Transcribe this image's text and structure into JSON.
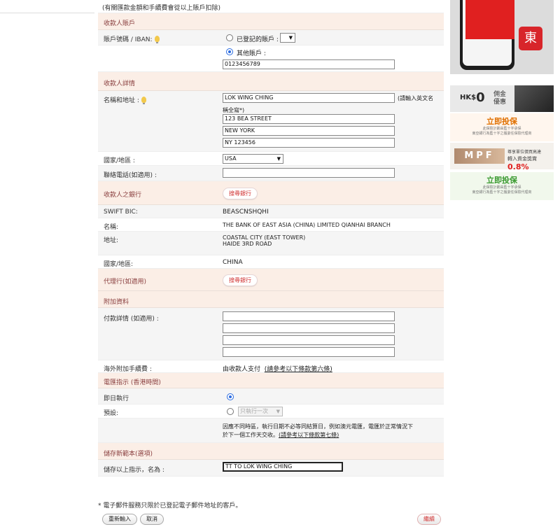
{
  "note_top": "(有關匯款金額和手續費會從以上賬戶扣除)",
  "payee_account": {
    "heading": "收款人賬戶",
    "account_label": "賬戶號碼 / IBAN:",
    "registered_label": "已登記的賬戶 :",
    "other_label": "其他賬戶 :",
    "account_value": "0123456789"
  },
  "payee_details": {
    "heading": "收款人詳情",
    "name_label": "名稱和地址 :",
    "name_value": "LOK WING CHING",
    "name_hint": "(請輸入英文名",
    "name_hint2": "稱全寫*)",
    "address1": "123 BEA STREET",
    "address2": "NEW YORK",
    "address3": "NY 123456",
    "country_label": "國家/地區 :",
    "country_value": "USA",
    "phone_label": "聯絡電話(如適用) :",
    "phone_value": ""
  },
  "payee_bank": {
    "heading": "收款人之銀行",
    "search_label": "搜尋銀行",
    "swift_label": "SWIFT BIC:",
    "swift_value": "BEASCNSHQHI",
    "bank_name_label": "名稱:",
    "bank_name_value": "THE BANK OF EAST ASIA (CHINA) LIMITED QIANHAI BRANCH",
    "address_label": "地址:",
    "address_line1": "COASTAL CITY (EAST TOWER)",
    "address_line2": "HAIDE 3RD ROAD",
    "country_label": "國家/地區:",
    "country_value": "CHINA"
  },
  "agent_bank": {
    "heading": "代理行(如適用)",
    "search_label": "搜尋銀行"
  },
  "additional": {
    "heading": "附加資料",
    "payment_details_label": "付款詳情 (如適用) :",
    "overseas_fee_label": "海外附加手續費 :",
    "overseas_fee_value": "由收款人支付",
    "overseas_fee_link": "(請參考以下條款第六條)"
  },
  "instruction": {
    "heading": "電匯指示 (香港時間)",
    "immediate_label": "即日執行",
    "schedule_label": "預設:",
    "schedule_select": "只執行一次",
    "notice_line1": "因應不同時區，執行日期不必等同結算日，例如澳元電匯，電匯於正常情況下",
    "notice_line2": "於下一個工作天交收。",
    "notice_link": "(請參考以下條款第七條)"
  },
  "template": {
    "heading": "儲存新範本(選項)",
    "save_label": "儲存以上指示，名為 :",
    "save_value": "TT TO LOK WING CHING"
  },
  "footnote": "* 電子郵件服務只限於已登記電子郵件地址的客戶。",
  "buttons": {
    "reset": "重新輸入",
    "cancel": "取消",
    "continue": "繼續"
  },
  "ads": {
    "badge_glyph": "東",
    "hk_text": "HK$",
    "hk_zero": "0",
    "commission": "佣金優惠",
    "insure_title": "立即投保",
    "insure_sub1": "此保險計劃由藍十字承保",
    "insure_sub2": "東亞銀行為藍十字之獲委任保險代理商",
    "mpf_text": "MPF",
    "mpf_line1": "尊享單位價買高達",
    "mpf_line2": "轉入資金獎賞",
    "mpf_pct": "0.8%",
    "insure2_title": "立即投保",
    "insure2_sub1": "此保險計劃由藍十字承保",
    "insure2_sub2": "東亞銀行為藍十字之獲委任保險代理商"
  },
  "colors": {
    "section_header_bg": "#fbeee6",
    "section_header_text": "#8a3f3f",
    "accent_red": "#d03030",
    "radio_blue": "#2a6be0"
  }
}
